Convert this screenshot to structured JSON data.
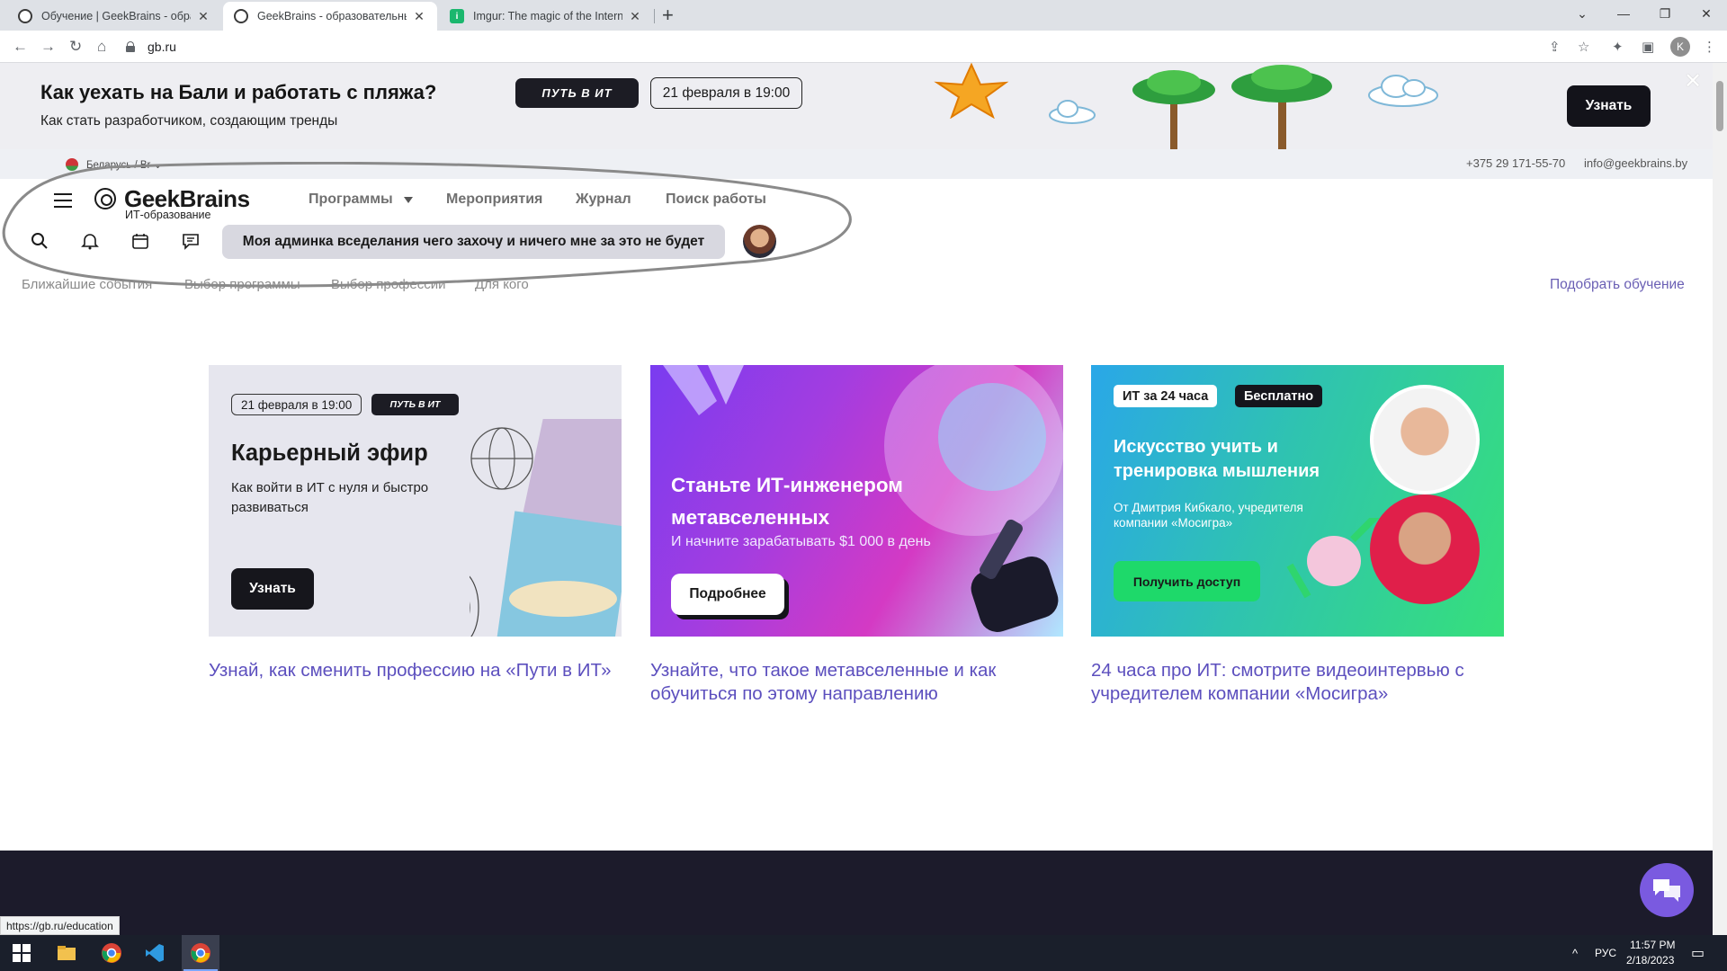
{
  "browser": {
    "tabs": [
      {
        "title": "Обучение | GeekBrains - образо",
        "active": false
      },
      {
        "title": "GeekBrains - образовательный",
        "active": true
      },
      {
        "title": "Imgur: The magic of the Internet",
        "active": false
      }
    ],
    "url": "gb.ru",
    "profile_initial": "K"
  },
  "promo": {
    "title": "Как уехать на Бали и работать с пляжа?",
    "subtitle": "Как стать разработчиком, создающим тренды",
    "logo": "ПУТЬ В ИТ",
    "date": "21 февраля в 19:00",
    "button": "Узнать",
    "close": "✕"
  },
  "region": {
    "location": "Беларусь / Br",
    "phone": "+375 29 171-55-70",
    "email": "info@geekbrains.by"
  },
  "header": {
    "logo": "GeekBrains",
    "logo_sub": "ИТ-образование",
    "menu": [
      "Программы",
      "Мероприятия",
      "Журнал",
      "Поиск работы"
    ],
    "motto": "Моя админка вседелания чего захочу и ничего мне за это не будет"
  },
  "subnav": {
    "items": [
      "Ближайшие события",
      "Выбор программы",
      "Выбор профессии",
      "Для кого"
    ],
    "pick": "Подобрать обучение"
  },
  "cards": [
    {
      "date": "21 февраля в 19:00",
      "logo": "ПУТЬ В ИТ",
      "heading": "Карьерный эфир",
      "text": "Как войти в ИТ с нуля и быстро развиваться",
      "button": "Узнать",
      "caption": "Узнай, как сменить профессию на «Пути в ИТ»"
    },
    {
      "heading": "Станьте ИТ-инженером метавселенных",
      "text": "И начните зарабатывать $1 000 в день",
      "button": "Подробнее",
      "caption": "Узнайте, что такое метавселенные и как обучиться по этому направлению"
    },
    {
      "tag1": "ИТ за 24 часа",
      "tag2": "Бесплатно",
      "heading": "Искусство учить и тренировка мышления",
      "text": "От Дмитрия Кибкало, учредителя компании «Мосигра»",
      "button": "Получить доступ",
      "caption": "24 часа про ИТ: смотрите видеоинтервью с учредителем компании «Мосигра»"
    }
  ],
  "status_url": "https://gb.ru/education",
  "taskbar": {
    "lang": "РУС",
    "time": "11:57 PM",
    "date": "2/18/2023"
  },
  "colors": {
    "link_purple": "#5c4fbe",
    "dark_button": "#16161c",
    "banner_bg": "#eeeef2"
  }
}
